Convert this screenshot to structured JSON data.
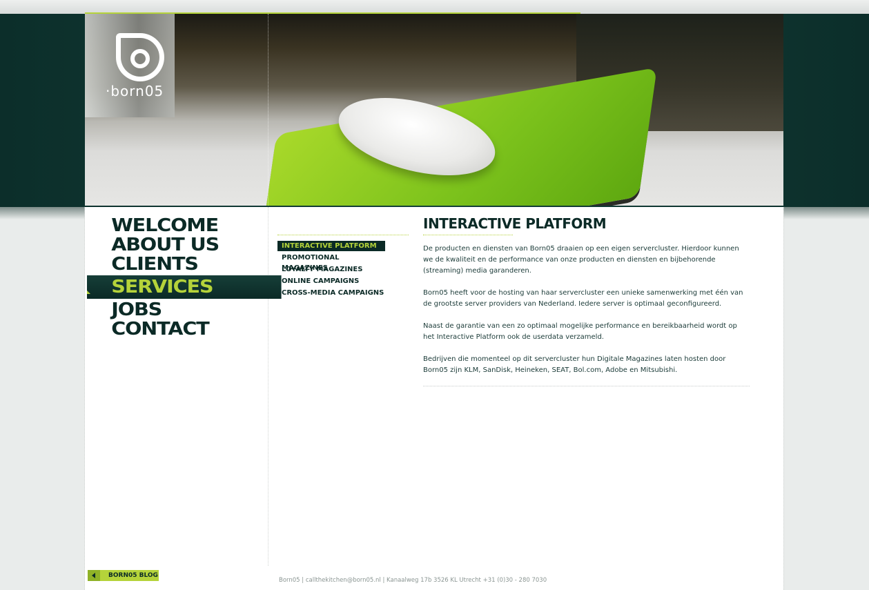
{
  "brand": {
    "logo_text": "·born05"
  },
  "main_nav": [
    {
      "label": "WELCOME",
      "active": false
    },
    {
      "label": "ABOUT US",
      "active": false
    },
    {
      "label": "CLIENTS",
      "active": false
    },
    {
      "label": "SERVICES",
      "active": true
    },
    {
      "label": "JOBS",
      "active": false
    },
    {
      "label": "CONTACT",
      "active": false
    }
  ],
  "sub_nav": [
    {
      "label": "INTERACTIVE PLATFORM",
      "active": true
    },
    {
      "label": "PROMOTIONAL MAGAZINES",
      "active": false
    },
    {
      "label": "LOYALTY MAGAZINES",
      "active": false
    },
    {
      "label": "ONLINE CAMPAIGNS",
      "active": false
    },
    {
      "label": "CROSS-MEDIA CAMPAIGNS",
      "active": false
    }
  ],
  "article": {
    "title": "INTERACTIVE PLATFORM",
    "paragraphs": [
      "De producten en diensten van Born05 draaien op een eigen servercluster. Hierdoor kunnen we de kwaliteit en de performance van onze producten en diensten en bijbehorende (streaming) media garanderen.",
      "Born05 heeft voor de hosting van haar servercluster een unieke samenwerking met één van de grootste server providers van Nederland. Iedere server is optimaal geconfigureerd.",
      "Naast de garantie van een zo optimaal mogelijke performance en bereikbaarheid wordt op het Interactive Platform ook de userdata verzameld.",
      "Bedrijven die momenteel op dit servercluster hun Digitale Magazines laten hosten door Born05 zijn KLM, SanDisk, Heineken, SEAT, Bol.com, Adobe en Mitsubishi."
    ]
  },
  "footer": {
    "blog_button": "BORN05 BLOG",
    "contact_line": "Born05 | callthekitchen@born05.nl | Kanaalweg 17b 3526 KL Utrecht +31 (0)30 - 280 7030"
  },
  "colors": {
    "accent": "#b5d33a",
    "dark": "#0b2a26"
  }
}
